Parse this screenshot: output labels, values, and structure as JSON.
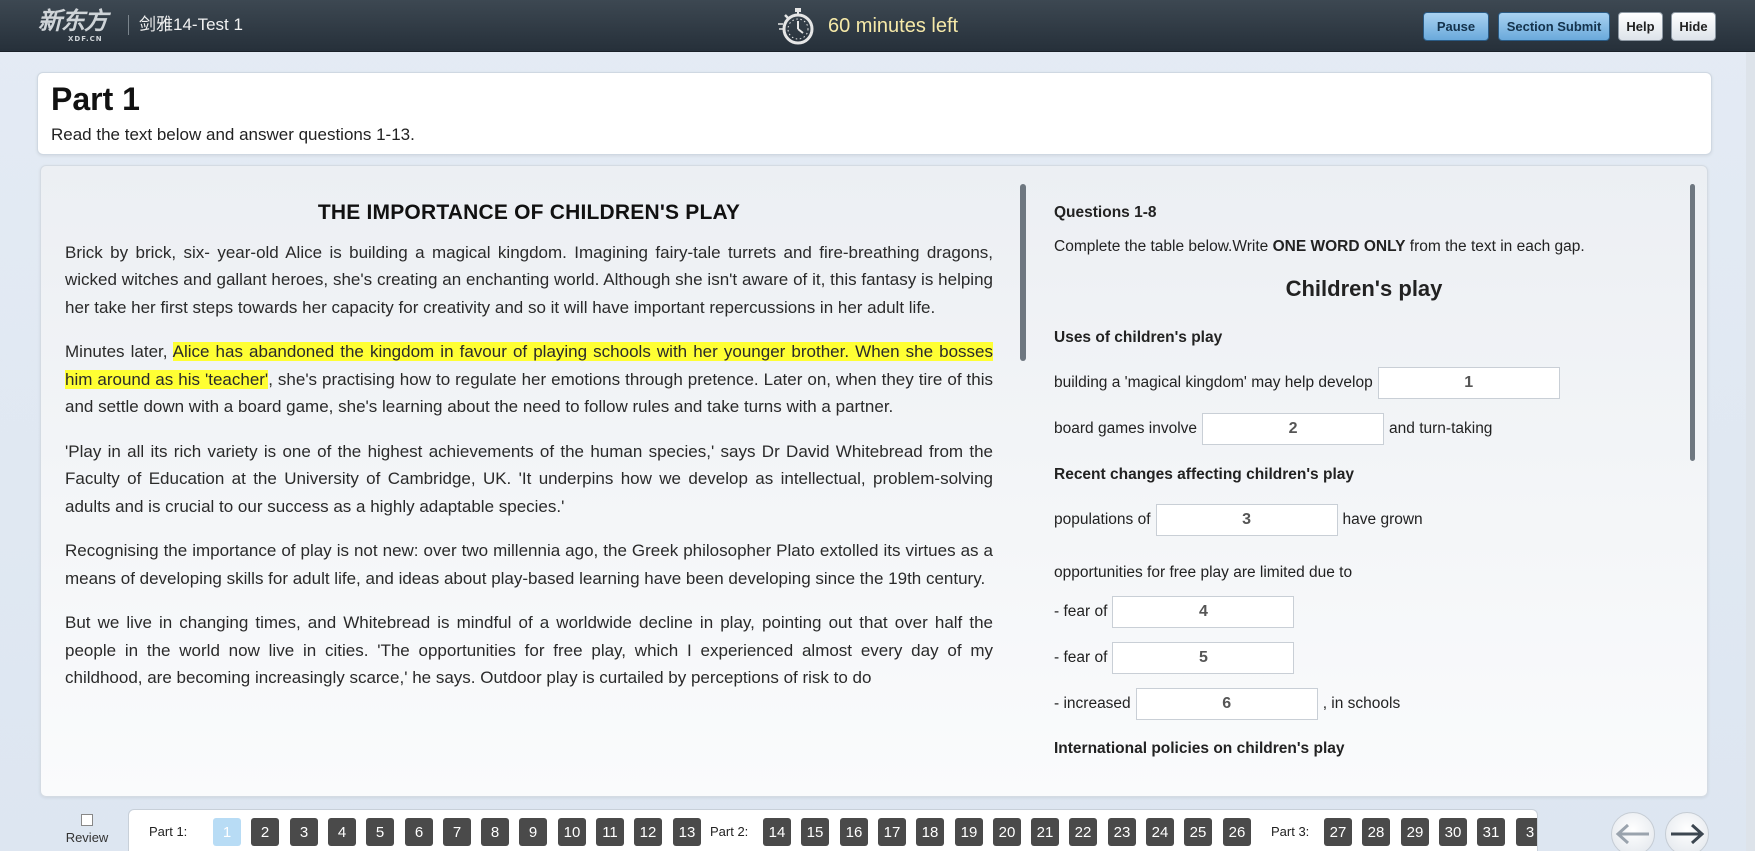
{
  "header": {
    "logo_cn": "新东方",
    "logo_en": "XDF.CN",
    "test_title": "剑雅14-Test 1",
    "timer_text": "60 minutes  left",
    "buttons": {
      "pause": "Pause",
      "section_submit": "Section Submit",
      "help": "Help",
      "hide": "Hide"
    }
  },
  "part": {
    "title": "Part 1",
    "instruction": "Read the text below and answer questions 1-13."
  },
  "passage": {
    "title": "THE IMPORTANCE OF CHILDREN'S PLAY",
    "p1": "Brick by brick, six- year-old Alice is building a magical kingdom. Imagining fairy-tale turrets and fire-breathing dragons, wicked witches and gallant heroes, she's creating an enchanting world. Although she isn't aware of it, this fantasy is helping her take her first steps towards her capacity for creativity and so it will have important repercussions in her adult life.",
    "p2_pre": "Minutes later, ",
    "p2_highlight": "Alice has abandoned the kingdom in favour of playing schools with her younger brother. When she bosses him around as his 'teacher'",
    "p2_post": ", she's practising how to regulate her emotions through pretence. Later on, when they tire of this and settle down with a board game, she's learning about the need to follow rules and take turns with a partner.",
    "p3": "'Play in all its rich variety is one of the highest achievements of the human species,' says Dr David Whitebread from the Faculty of Education at the University of Cambridge, UK. 'It underpins how we develop as intellectual, problem-solving adults and is crucial to our success as a highly adaptable species.'",
    "p4": "Recognising the importance of play is not new: over two millennia ago, the Greek philosopher Plato extolled its virtues as a means of developing skills for adult life, and ideas about play-based learning have been developing since the 19th century.",
    "p5": "But we live in changing times, and Whitebread is mindful of a worldwide decline in play, pointing out that over half the people in the world now live in cities. 'The opportunities for free play, which I experienced almost every day of my childhood, are becoming increasingly scarce,' he says. Outdoor play is curtailed by perceptions of risk to do"
  },
  "questions": {
    "heading": "Questions 1-8",
    "instr_pre": "Complete the table below.Write ",
    "instr_bold": "ONE WORD ONLY",
    "instr_post": " from the text in each gap.",
    "table_title": "Children's play",
    "uses_heading": "Uses of children's play",
    "q1_pre": "building a 'magical kingdom' may help develop",
    "q1_num": "1",
    "q2_pre": "board games involve",
    "q2_num": "2",
    "q2_post": "and turn-taking",
    "changes_heading": "Recent changes affecting children's play",
    "q3_pre": "populations of",
    "q3_num": "3",
    "q3_post": "have grown",
    "limited_text": "opportunities for free play are limited due to",
    "q4_pre": "- fear of",
    "q4_num": "4",
    "q5_pre": "- fear of",
    "q5_num": "5",
    "q6_pre": "- increased",
    "q6_num": "6",
    "q6_post": ", in schools",
    "intl_heading": "International policies on children's play"
  },
  "navigation": {
    "review_label": "Review",
    "part1_label": "Part 1:",
    "part2_label": "Part 2:",
    "part3_label": "Part 3:",
    "part1_nums": [
      "1",
      "2",
      "3",
      "4",
      "5",
      "6",
      "7",
      "8",
      "9",
      "10",
      "11",
      "12",
      "13"
    ],
    "part2_nums": [
      "14",
      "15",
      "16",
      "17",
      "18",
      "19",
      "20",
      "21",
      "22",
      "23",
      "24",
      "25",
      "26"
    ],
    "part3_nums": [
      "27",
      "28",
      "29",
      "30",
      "31",
      "3"
    ],
    "active_question": "1",
    "prev_icon": "arrow-left-icon",
    "next_icon": "arrow-right-icon"
  },
  "colors": {
    "highlight": "#ffff33",
    "topbar": "#2f3a44",
    "timer": "#f6e9a8",
    "nav_active": "#b8dcf5"
  }
}
